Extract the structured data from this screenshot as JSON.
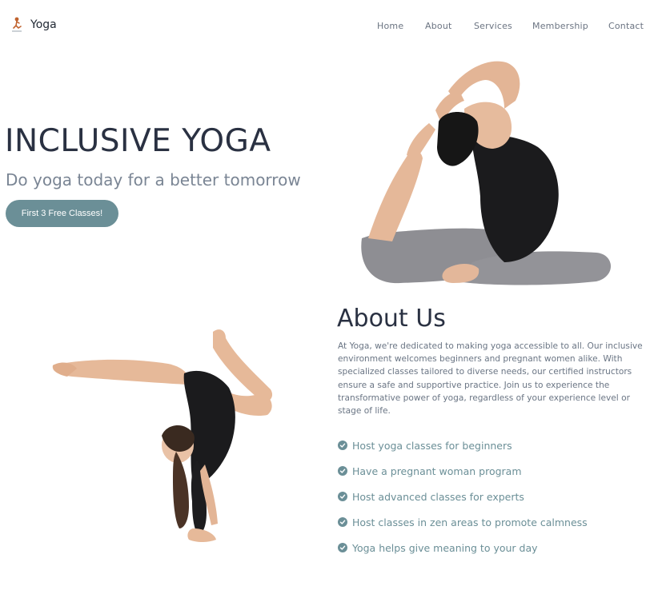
{
  "header": {
    "brand_name": "Yoga",
    "brand_icon": "yoga-pose-logo-icon",
    "nav": [
      {
        "label": "Home"
      },
      {
        "label": "About"
      },
      {
        "label": "Services"
      },
      {
        "label": "Membership"
      },
      {
        "label": "Contact"
      }
    ]
  },
  "hero": {
    "title": "INCLUSIVE YOGA",
    "subtitle": "Do yoga today for a better tomorrow",
    "cta_label": "First 3 Free Classes!"
  },
  "about": {
    "title": "About Us",
    "text": "At Yoga, we're dedicated to making yoga accessible to all. Our inclusive environment welcomes beginners and pregnant women alike. With specialized classes tailored to diverse needs, our certified instructors ensure a safe and supportive practice. Join us to experience the transformative power of yoga, regardless of your experience level or stage of life.",
    "features": [
      "Host yoga classes for beginners",
      "Have a pregnant woman program",
      "Host advanced classes for experts",
      "Host classes in zen areas to promote calmness",
      "Yoga helps give meaning to your day"
    ]
  },
  "colors": {
    "accent": "#6b8f97",
    "heading": "#2a3142",
    "body_text": "#6a7584",
    "nav_text": "#6b7482"
  }
}
